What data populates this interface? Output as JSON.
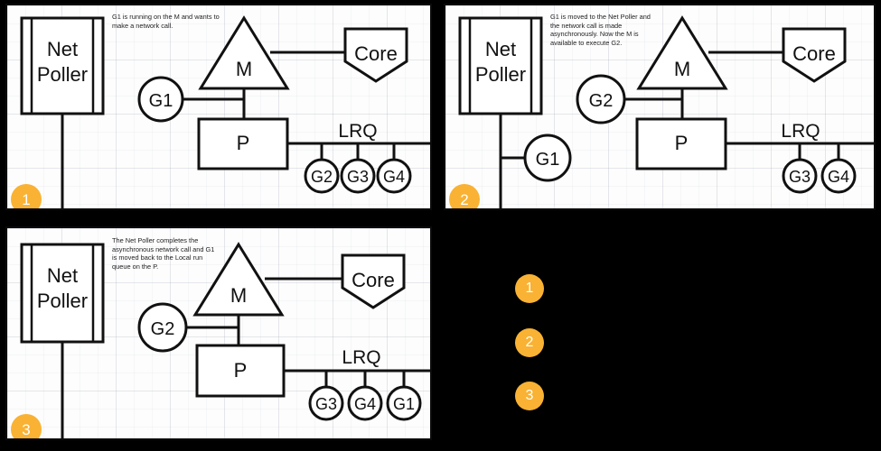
{
  "meta": {
    "background_color": "#000000",
    "panel_background": "#fdfdfd",
    "badge_color": "#f9b233",
    "stroke_color": "#111111"
  },
  "panels": [
    {
      "number": "1",
      "caption": "G1 is running on the M and wants to make a network call.",
      "netpoller_label_line1": "Net",
      "netpoller_label_line2": "Poller",
      "core_label": "Core",
      "m_label": "M",
      "p_label": "P",
      "lrq_label": "LRQ",
      "attached_goroutine": "G1",
      "netpoller_goroutine": "",
      "lrq_goroutines": [
        "G2",
        "G3",
        "G4"
      ]
    },
    {
      "number": "2",
      "caption": "G1 is moved to the Net Poller and the network call is made asynchronously. Now the M is available to execute G2.",
      "netpoller_label_line1": "Net",
      "netpoller_label_line2": "Poller",
      "core_label": "Core",
      "m_label": "M",
      "p_label": "P",
      "lrq_label": "LRQ",
      "attached_goroutine": "G2",
      "netpoller_goroutine": "G1",
      "lrq_goroutines": [
        "G3",
        "G4"
      ]
    },
    {
      "number": "3",
      "caption": "The Net Poller completes the asynchronous network call and G1 is moved back to the Local run queue on the P.",
      "netpoller_label_line1": "Net",
      "netpoller_label_line2": "Poller",
      "core_label": "Core",
      "m_label": "M",
      "p_label": "P",
      "lrq_label": "LRQ",
      "attached_goroutine": "G2",
      "netpoller_goroutine": "",
      "lrq_goroutines": [
        "G3",
        "G4",
        "G1"
      ]
    }
  ],
  "legend": {
    "items": [
      {
        "number": "1"
      },
      {
        "number": "2"
      },
      {
        "number": "3"
      }
    ]
  }
}
